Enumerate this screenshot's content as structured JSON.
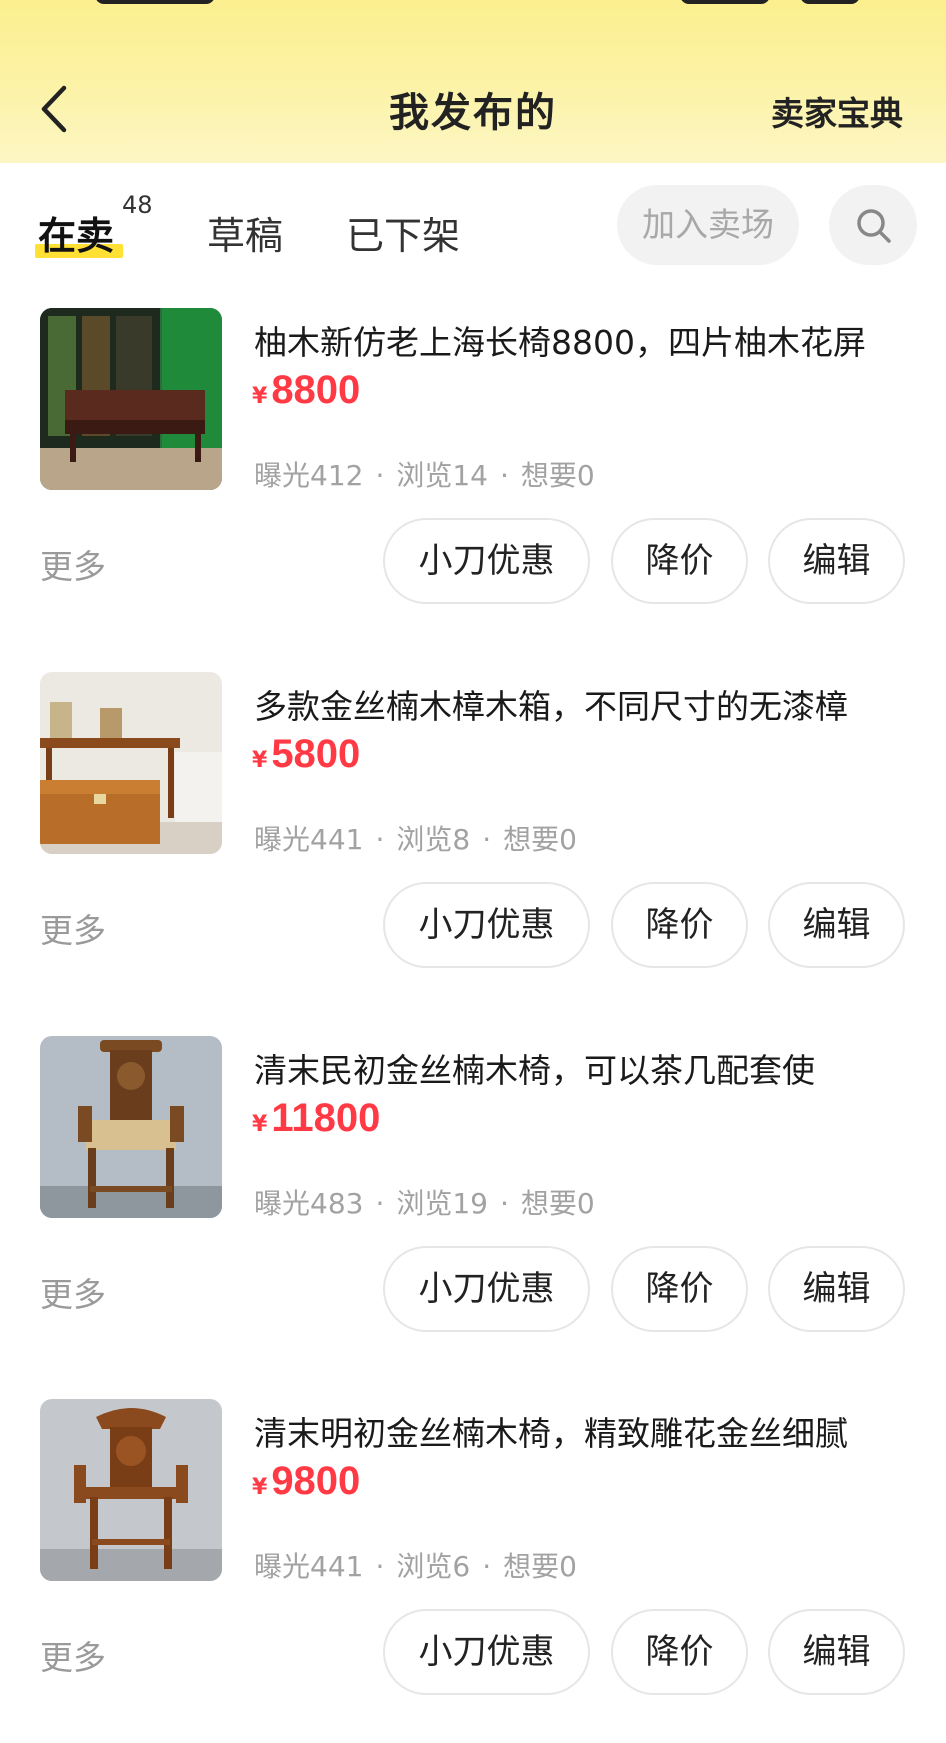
{
  "header": {
    "title": "我发布的",
    "seller_guide": "卖家宝典",
    "background_color": "#fcf3a8"
  },
  "tabs": {
    "on_sale_label": "在卖",
    "on_sale_count": "48",
    "drafts_label": "草稿",
    "removed_label": "已下架",
    "join_market_label": "加入卖场"
  },
  "items": [
    {
      "title": "柚木新仿老上海长椅8800，四片柚木花屏",
      "currency": "¥",
      "price": "8800",
      "exposure": "曝光412",
      "views": "浏览14",
      "wants": "想要0",
      "image": "bench-with-screens"
    },
    {
      "title": "多款金丝楠木樟木箱，不同尺寸的无漆樟",
      "currency": "¥",
      "price": "5800",
      "exposure": "曝光441",
      "views": "浏览8",
      "wants": "想要0",
      "image": "camphor-chest-room"
    },
    {
      "title": "清末民初金丝楠木椅，可以茶几配套使",
      "currency": "¥",
      "price": "11800",
      "exposure": "曝光483",
      "views": "浏览19",
      "wants": "想要0",
      "image": "carved-armchair"
    },
    {
      "title": "清末明初金丝楠木椅，精致雕花金丝细腻",
      "currency": "¥",
      "price": "9800",
      "exposure": "曝光441",
      "views": "浏览6",
      "wants": "想要0",
      "image": "carved-armchair-2"
    }
  ],
  "actions": {
    "more_label": "更多",
    "coupon_label": "小刀优惠",
    "reduce_label": "降价",
    "edit_label": "编辑"
  },
  "separator": "·",
  "colors": {
    "price": "#ff3a45",
    "tab_highlight": "#ffe033"
  }
}
